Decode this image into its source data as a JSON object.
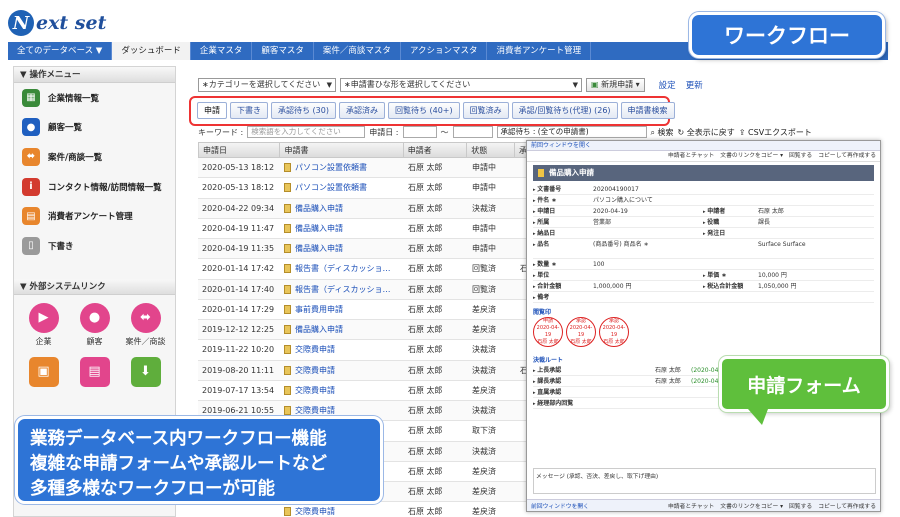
{
  "logo": {
    "text": "ext set",
    "letter": "N"
  },
  "topnav": [
    "全てのデータベース ▼",
    "ダッシュボード",
    "企業マスタ",
    "顧客マスタ",
    "案件／商談マスタ",
    "アクションマスタ",
    "消費者アンケート管理"
  ],
  "badges": {
    "workflow": "ワークフロー",
    "form": "申請フォーム",
    "bottom": [
      "業務データベース内ワークフロー機能",
      "複雑な申請フォームや承認ルートなど",
      "多種多様なワークフローが可能"
    ]
  },
  "sidebar": {
    "ops_title": "▼ 操作メニュー",
    "items": [
      {
        "label": "企業情報一覧",
        "icon": "building-icon",
        "color": "#3a8a3a",
        "glyph": "▦"
      },
      {
        "label": "顧客一覧",
        "icon": "person-icon",
        "color": "#1f5fc0",
        "glyph": "●"
      },
      {
        "label": "案件/商談一覧",
        "icon": "handshake-icon",
        "color": "#e8862d",
        "glyph": "⬌"
      },
      {
        "label": "コンタクト情報/訪問情報一覧",
        "icon": "info-icon",
        "color": "#d33b2f",
        "glyph": "i"
      },
      {
        "label": "消費者アンケート管理",
        "icon": "clipboard-icon",
        "color": "#e8862d",
        "glyph": "▤"
      },
      {
        "label": "下書き",
        "icon": "draft-icon",
        "color": "#9a9a9a",
        "glyph": "▯"
      }
    ],
    "ext_title": "▼ 外部システムリンク",
    "ext": [
      {
        "label": "企業",
        "icon": "play-icon",
        "color": "#e2458c",
        "glyph": "▶",
        "shape": ""
      },
      {
        "label": "顧客",
        "icon": "customer-icon",
        "color": "#e2458c",
        "glyph": "●",
        "shape": ""
      },
      {
        "label": "案件／商談",
        "icon": "handshake-icon",
        "color": "#e2458c",
        "glyph": "⬌",
        "shape": ""
      },
      {
        "label": "",
        "icon": "user-desk-icon",
        "color": "#e8862d",
        "glyph": "▣",
        "shape": "sq"
      },
      {
        "label": "",
        "icon": "id-card-icon",
        "color": "#e2458c",
        "glyph": "▤",
        "shape": "sq"
      },
      {
        "label": "",
        "icon": "download-icon",
        "color": "#5fae3c",
        "glyph": "⬇",
        "shape": "sq"
      }
    ]
  },
  "selectors": {
    "category": "∗カテゴリーを選択してください",
    "template": "∗申請書ひな形を選択してください",
    "new_button": "新規申請",
    "settings": "設定",
    "refresh": "更新"
  },
  "tabs": [
    "申請",
    "下書き",
    "承認待ち (30)",
    "承認済み",
    "回覧待ち (40+)",
    "回覧済み",
    "承認/回覧待ち(代理) (26)",
    "申請書検索"
  ],
  "filter": {
    "keyword_label": "キーワード :",
    "keyword_placeholder": "検索語を入力してください",
    "date_label": "申請日 :",
    "tilde": "〜",
    "status_select": "承認待ち : (全ての申請書)",
    "search": "検索",
    "show_all": "全表示に戻す",
    "csv": "CSVエクスポート"
  },
  "table": {
    "headers": [
      "申請日",
      "申請書",
      "申請者",
      "状態",
      "承"
    ],
    "rows": [
      [
        "2020-05-13 18:12",
        "パソコン設置依頼書",
        "石原 太郎",
        "申請中",
        ""
      ],
      [
        "2020-05-13 18:12",
        "パソコン設置依頼書",
        "石原 太郎",
        "申請中",
        ""
      ],
      [
        "2020-04-22 09:34",
        "備品購入申請",
        "石原 太郎",
        "決裁済",
        ""
      ],
      [
        "2020-04-19 11:47",
        "備品購入申請",
        "石原 太郎",
        "申請中",
        ""
      ],
      [
        "2020-04-19 11:35",
        "備品購入申請",
        "石原 太郎",
        "申請中",
        ""
      ],
      [
        "2020-01-14 17:42",
        "報告書（ディスカッショ…",
        "石原 太郎",
        "回覧済",
        "石"
      ],
      [
        "2020-01-14 17:40",
        "報告書（ディスカッショ…",
        "石原 太郎",
        "回覧済",
        ""
      ],
      [
        "2020-01-14 17:29",
        "事前費用申請",
        "石原 太郎",
        "差戻済",
        ""
      ],
      [
        "2019-12-12 12:25",
        "備品購入申請",
        "石原 太郎",
        "差戻済",
        ""
      ],
      [
        "2019-11-22 10:20",
        "交際費申請",
        "石原 太郎",
        "決裁済",
        ""
      ],
      [
        "2019-08-20 11:11",
        "交際費申請",
        "石原 太郎",
        "決裁済",
        "石"
      ],
      [
        "2019-07-17 13:54",
        "交際費申請",
        "石原 太郎",
        "差戻済",
        ""
      ],
      [
        "2019-06-21 10:55",
        "交際費申請",
        "石原 太郎",
        "決裁済",
        ""
      ],
      [
        "",
        "交際費申請",
        "石原 太郎",
        "取下済",
        ""
      ],
      [
        "",
        "交際費申請",
        "石原 太郎",
        "決裁済",
        ""
      ],
      [
        "",
        "交際費申請",
        "石原 太郎",
        "差戻済",
        ""
      ],
      [
        "",
        "交際費申請",
        "石原 太郎",
        "差戻済",
        ""
      ],
      [
        "",
        "交際費申請",
        "石原 太郎",
        "差戻済",
        ""
      ]
    ]
  },
  "form": {
    "top_link": "前回ウィンドウを開く",
    "tools": [
      "申請者とチャット",
      "文書のリンクをコピー ▾",
      "回覧する",
      "コピーして再作成する"
    ],
    "title": "備品購入申請",
    "fields": [
      [
        "文書番号",
        "202004190017",
        "",
        ""
      ],
      [
        "件名 ∗",
        "パソコン購入について",
        "",
        ""
      ],
      [
        "申請日",
        "2020-04-19",
        "申請者",
        "石原 太郎"
      ],
      [
        "所属",
        "営業部",
        "役職",
        "課長"
      ],
      [
        "納品日",
        "",
        "発注日",
        ""
      ],
      [
        "品名",
        "(商品番号)  商品名 ∗",
        "",
        "Surface  Surface"
      ],
      [
        "数量 ∗",
        "100",
        "",
        ""
      ],
      [
        "単位",
        "",
        "単価 ∗",
        "10,000 円"
      ],
      [
        "合計金額",
        "1,000,000 円",
        "税込合計金額",
        "1,050,000 円"
      ],
      [
        "備考",
        "",
        "",
        ""
      ]
    ],
    "stamp_title": "閲覧印",
    "stamps": [
      [
        "申請",
        "2020-04-19",
        "石原 太郎"
      ],
      [
        "承認",
        "2020-04-19",
        "石原 太郎"
      ],
      [
        "承認",
        "2020-04-19",
        "石原 太郎"
      ]
    ],
    "route_title": "決裁ルート",
    "route": [
      [
        "上長承認",
        "石原 太郎",
        "(2020-04-19 承認済)"
      ],
      [
        "課長承認",
        "石原 太郎",
        "(2020-04-19 承認済)"
      ],
      [
        "直属承認",
        "",
        ""
      ],
      [
        "経理部内回覧",
        "",
        ""
      ]
    ],
    "message_label": "メッセージ (承認、否決、差戻し、取下げ理由)",
    "bottom_link": "前回ウィンドウを開く",
    "bottom_tools": [
      "申請者とチャット",
      "文書のリンクをコピー ▾",
      "回覧する",
      "コピーして再作成する"
    ]
  }
}
